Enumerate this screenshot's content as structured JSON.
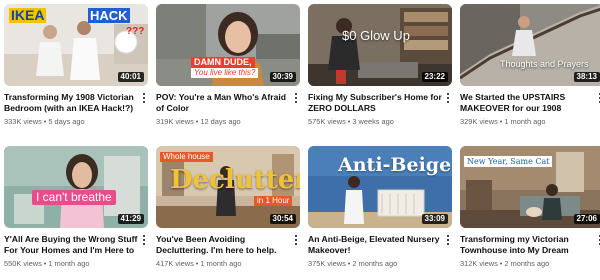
{
  "videos": [
    {
      "title": "Transforming My 1908 Victorian Bedroom (with an IKEA Hack!?)",
      "views": "333K views",
      "age": "5 days ago",
      "duration": "40:01",
      "overlay": {
        "ikea": "IKEA",
        "hack": "HACK",
        "marks": "???"
      }
    },
    {
      "title": "POV: You're a Man Who's Afraid of Color",
      "views": "319K views",
      "age": "12 days ago",
      "duration": "30:39",
      "overlay": {
        "line1": "DAMN DUDE,",
        "line2": "You live like this?"
      }
    },
    {
      "title": "Fixing My Subscriber's Home for ZERO DOLLARS",
      "views": "575K views",
      "age": "3 weeks ago",
      "duration": "23:22",
      "overlay": {
        "text": "$0 Glow Up"
      }
    },
    {
      "title": "We Started the UPSTAIRS MAKEOVER for our 1908 Victorian…",
      "views": "329K views",
      "age": "1 month ago",
      "duration": "38:13",
      "overlay": {
        "text": "Thoughts and Prayers"
      }
    },
    {
      "title": "Y'All Are Buying the Wrong Stuff For Your Homes and I'm Here to Help.",
      "views": "550K views",
      "age": "1 month ago",
      "duration": "41:29",
      "overlay": {
        "text": "I can't breathe"
      }
    },
    {
      "title": "You've Been Avoiding Decluttering. I'm here to help.",
      "views": "417K views",
      "age": "1 month ago",
      "duration": "30:54",
      "overlay": {
        "badge": "Whole house",
        "big": "Declutter",
        "sub": "in 1 Hour"
      }
    },
    {
      "title": "An Anti-Beige, Elevated Nursery Makeover!",
      "views": "375K views",
      "age": "2 months ago",
      "duration": "33:09",
      "overlay": {
        "text": "Anti-Beige"
      }
    },
    {
      "title": "Transforming my Victorian Townhouse into My Dream Home",
      "views": "312K views",
      "age": "2 months ago",
      "duration": "27:06",
      "overlay": {
        "text": "New Year, Same Cat"
      }
    }
  ],
  "separator": "•",
  "colors": {
    "duration_bg": "#000000",
    "meta_text": "#606060",
    "title_text": "#0f0f0f"
  }
}
